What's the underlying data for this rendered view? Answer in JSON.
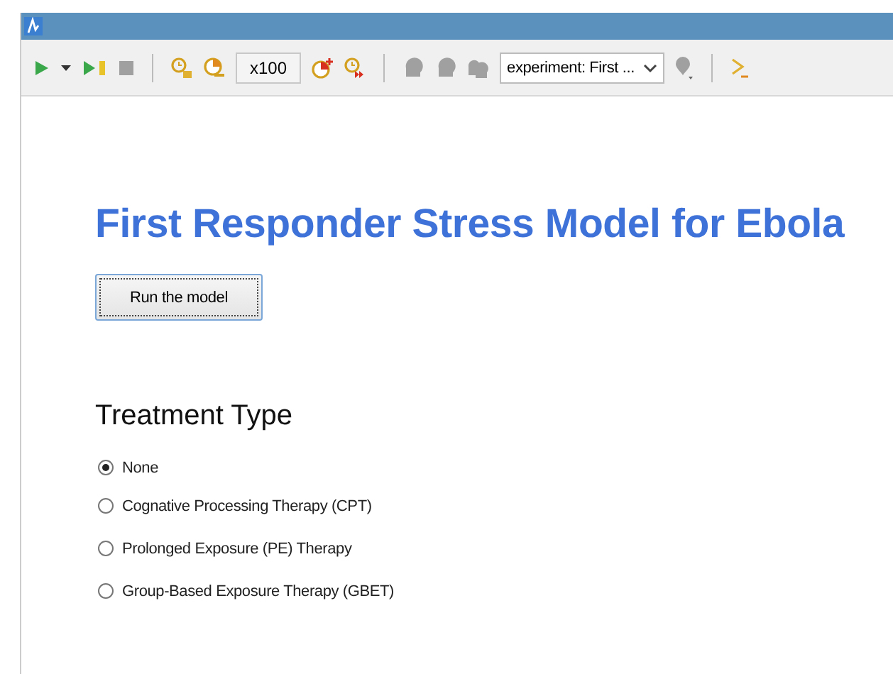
{
  "toolbar": [
    {
      "kind": "play",
      "disabled": false
    },
    {
      "kind": "caret",
      "disabled": false
    },
    {
      "kind": "step",
      "disabled": false
    },
    {
      "kind": "stop",
      "disabled": true
    },
    {
      "kind": "separator"
    },
    {
      "kind": "clock-one",
      "disabled": false
    },
    {
      "kind": "clock-pie",
      "disabled": false
    },
    {
      "kind": "field",
      "value": "x100"
    },
    {
      "kind": "clock-plus",
      "disabled": false
    },
    {
      "kind": "clock-fast",
      "disabled": false
    },
    {
      "kind": "separator"
    },
    {
      "kind": "head-x",
      "disabled": true
    },
    {
      "kind": "head",
      "disabled": true
    },
    {
      "kind": "head-pair",
      "disabled": true
    },
    {
      "kind": "select",
      "value": "experiment: First ..."
    },
    {
      "kind": "pin",
      "disabled": true
    },
    {
      "kind": "separator"
    },
    {
      "kind": "trace",
      "disabled": false
    }
  ],
  "title": "First Responder Stress Model for Ebola",
  "run_button": "Run the model",
  "section_heading": "Treatment Type",
  "options": [
    {
      "label": "None",
      "selected": true
    },
    {
      "label": "Cognative Processing Therapy (CPT)",
      "selected": false
    },
    {
      "label": "Prolonged Exposure (PE) Therapy",
      "selected": false
    },
    {
      "label": "Group-Based Exposure Therapy (GBET)",
      "selected": false
    }
  ]
}
